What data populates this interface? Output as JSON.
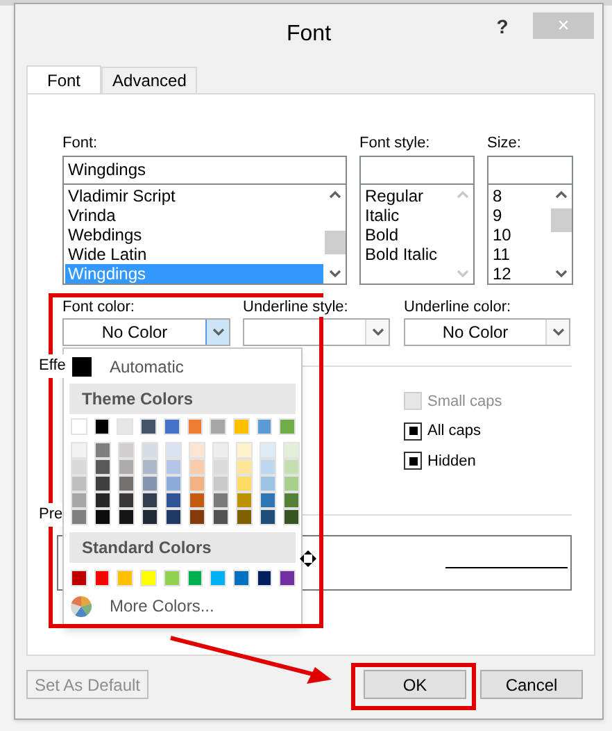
{
  "window": {
    "title": "Font",
    "help": "?",
    "close": "×"
  },
  "tabs": [
    {
      "label": "Font",
      "selected": true
    },
    {
      "label": "Advanced",
      "selected": false
    }
  ],
  "font": {
    "label": "Font:",
    "value": "Wingdings",
    "items": [
      {
        "label": "Vladimir Script",
        "selected": false
      },
      {
        "label": "Vrinda",
        "selected": false
      },
      {
        "label": "Webdings",
        "selected": false
      },
      {
        "label": "Wide Latin",
        "selected": false
      },
      {
        "label": "Wingdings",
        "selected": true
      }
    ]
  },
  "font_style": {
    "label": "Font style:",
    "items": [
      {
        "label": "Regular",
        "selected": false
      },
      {
        "label": "Italic",
        "selected": false
      },
      {
        "label": "Bold",
        "selected": false
      },
      {
        "label": "Bold Italic",
        "selected": false
      }
    ]
  },
  "size": {
    "label": "Size:",
    "items": [
      {
        "label": "8",
        "selected": false
      },
      {
        "label": "9",
        "selected": false
      },
      {
        "label": "10",
        "selected": false
      },
      {
        "label": "11",
        "selected": false
      },
      {
        "label": "12",
        "selected": false
      }
    ]
  },
  "font_color": {
    "label": "Font color:",
    "value": "No Color",
    "expanded": true
  },
  "underline_style": {
    "label": "Underline style:"
  },
  "underline_color": {
    "label": "Underline color:",
    "value": "No Color"
  },
  "effects": {
    "label": "Effe",
    "items": [
      {
        "label": "Small caps",
        "checked": false,
        "disabled": true
      },
      {
        "label": "All caps",
        "checked": true,
        "disabled": false
      },
      {
        "label": "Hidden",
        "checked": true,
        "disabled": false
      }
    ]
  },
  "preview": {
    "label": "Pre"
  },
  "color_menu": {
    "automatic": "Automatic",
    "theme_heading": "Theme Colors",
    "theme_colors": [
      {
        "color": "#ffffff",
        "shades": [
          {
            "color": "#f2f2f2"
          },
          {
            "color": "#d9d9d9"
          },
          {
            "color": "#bfbfbf"
          },
          {
            "color": "#a6a6a6"
          },
          {
            "color": "#808080"
          }
        ]
      },
      {
        "color": "#000000",
        "shades": [
          {
            "color": "#7f7f7f"
          },
          {
            "color": "#595959"
          },
          {
            "color": "#404040"
          },
          {
            "color": "#262626"
          },
          {
            "color": "#0d0d0d"
          }
        ]
      },
      {
        "color": "#e7e6e6",
        "shades": [
          {
            "color": "#d0cece"
          },
          {
            "color": "#aeabab"
          },
          {
            "color": "#757171"
          },
          {
            "color": "#3a3838"
          },
          {
            "color": "#171616"
          }
        ]
      },
      {
        "color": "#44546a",
        "shades": [
          {
            "color": "#d6dce4"
          },
          {
            "color": "#adb9ca"
          },
          {
            "color": "#8497b0"
          },
          {
            "color": "#333f4f"
          },
          {
            "color": "#222a35"
          }
        ]
      },
      {
        "color": "#4472c4",
        "shades": [
          {
            "color": "#d9e2f3"
          },
          {
            "color": "#b4c6e7"
          },
          {
            "color": "#8eaadb"
          },
          {
            "color": "#2f5496"
          },
          {
            "color": "#1f3864"
          }
        ]
      },
      {
        "color": "#ed7d31",
        "shades": [
          {
            "color": "#fbe5d5"
          },
          {
            "color": "#f7cbac"
          },
          {
            "color": "#f4b183"
          },
          {
            "color": "#c55a11"
          },
          {
            "color": "#843c0c"
          }
        ]
      },
      {
        "color": "#a5a5a5",
        "shades": [
          {
            "color": "#ededed"
          },
          {
            "color": "#dbdbdb"
          },
          {
            "color": "#c9c9c9"
          },
          {
            "color": "#7b7b7b"
          },
          {
            "color": "#525252"
          }
        ]
      },
      {
        "color": "#ffc000",
        "shades": [
          {
            "color": "#fff2cc"
          },
          {
            "color": "#ffe599"
          },
          {
            "color": "#ffd966"
          },
          {
            "color": "#bf9000"
          },
          {
            "color": "#7f6000"
          }
        ]
      },
      {
        "color": "#5b9bd5",
        "shades": [
          {
            "color": "#deeaf6"
          },
          {
            "color": "#bdd7ee"
          },
          {
            "color": "#9cc3e5"
          },
          {
            "color": "#2e75b5"
          },
          {
            "color": "#1f4e79"
          }
        ]
      },
      {
        "color": "#70ad47",
        "shades": [
          {
            "color": "#e2efd9"
          },
          {
            "color": "#c5e0b3"
          },
          {
            "color": "#a8d08d"
          },
          {
            "color": "#538135"
          },
          {
            "color": "#375623"
          }
        ]
      }
    ],
    "standard_heading": "Standard Colors",
    "standard_colors": [
      {
        "color": "#c00000"
      },
      {
        "color": "#ff0000"
      },
      {
        "color": "#ffc000"
      },
      {
        "color": "#ffff00"
      },
      {
        "color": "#92d050"
      },
      {
        "color": "#00b050"
      },
      {
        "color": "#00b0f0"
      },
      {
        "color": "#0070c0"
      },
      {
        "color": "#002060"
      },
      {
        "color": "#7030a0"
      }
    ],
    "more": "More Colors..."
  },
  "buttons": [
    {
      "label": "Set As Default",
      "disabled": true
    },
    {
      "label": "OK",
      "disabled": false
    },
    {
      "label": "Cancel",
      "disabled": false
    }
  ]
}
